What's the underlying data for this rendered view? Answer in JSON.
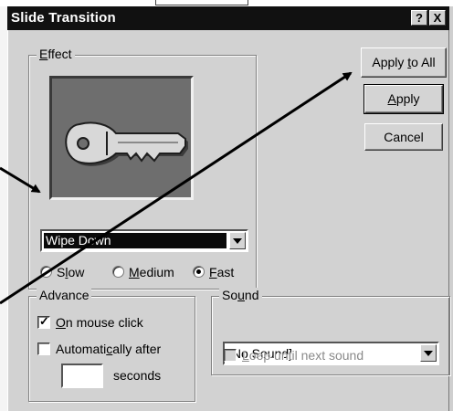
{
  "dialog": {
    "title": "Slide Transition",
    "help_label": "?",
    "close_label": "X"
  },
  "effect": {
    "legend_ul": "E",
    "legend_rest": "ffect",
    "selected": "Wipe Down",
    "speeds": [
      {
        "label_pre": "S",
        "label_ul": "l",
        "label_post": "ow",
        "selected": false
      },
      {
        "label_pre": "",
        "label_ul": "M",
        "label_post": "edium",
        "selected": false
      },
      {
        "label_pre": "",
        "label_ul": "F",
        "label_post": "ast",
        "selected": true
      }
    ]
  },
  "buttons": {
    "apply_all_pre": "Apply ",
    "apply_all_ul": "t",
    "apply_all_post": "o All",
    "apply_ul": "A",
    "apply_post": "pply",
    "cancel": "Cancel"
  },
  "advance": {
    "legend": "Advance",
    "on_click_ul": "O",
    "on_click_post": "n mouse click",
    "on_click_checked": true,
    "auto_pre": "Automati",
    "auto_ul": "c",
    "auto_post": "ally after",
    "auto_checked": false,
    "seconds_value": "",
    "seconds_label": "seconds"
  },
  "sound": {
    "legend_pre": "So",
    "legend_ul": "u",
    "legend_post": "nd",
    "selected": "[No Sound]",
    "loop_ul": "L",
    "loop_post": "oop until next sound",
    "loop_checked": false
  },
  "colors": {
    "titlebar": "#111111",
    "dialog_bg": "#d2d2d2",
    "selection": "#0a0a0a"
  },
  "icons": {
    "preview": "key-icon",
    "dropdown": "chevron-down-icon",
    "annotation": "arrow-icon"
  }
}
